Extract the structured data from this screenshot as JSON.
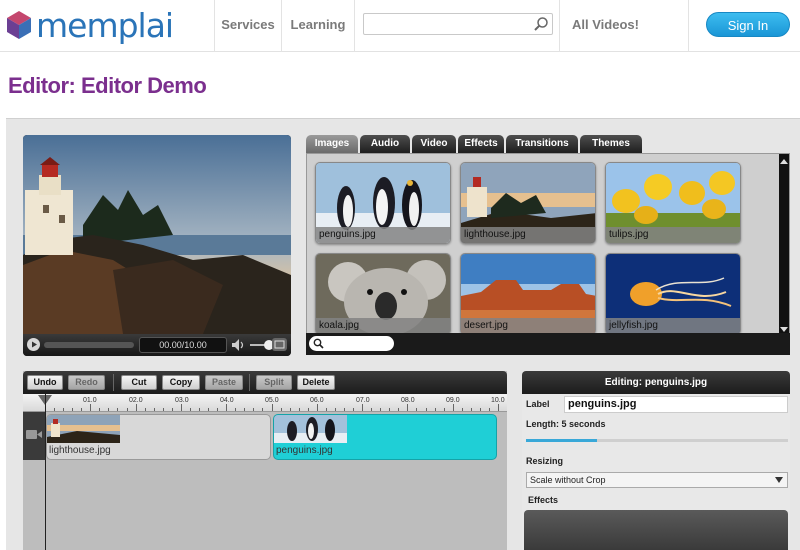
{
  "header": {
    "brand": "memplai",
    "nav": [
      "Services",
      "Learning"
    ],
    "search": {
      "value": "",
      "placeholder": ""
    },
    "all_videos": "All Videos!",
    "sign_in": "Sign In"
  },
  "page_title": "Editor: Editor Demo",
  "player": {
    "time": "00.00/10.00",
    "progress_fraction": 0.0,
    "volume_fraction": 0.6
  },
  "library": {
    "tabs": [
      "Images",
      "Audio",
      "Video",
      "Effects",
      "Transitions",
      "Themes"
    ],
    "active_tab": "Images",
    "items": [
      {
        "label": "penguins.jpg",
        "image": "penguins"
      },
      {
        "label": "lighthouse.jpg",
        "image": "lighthouse"
      },
      {
        "label": "tulips.jpg",
        "image": "tulips"
      },
      {
        "label": "koala.jpg",
        "image": "koala"
      },
      {
        "label": "desert.jpg",
        "image": "desert"
      },
      {
        "label": "jellyfish.jpg",
        "image": "jellyfish"
      }
    ],
    "search": {
      "value": "",
      "placeholder": ""
    }
  },
  "timeline": {
    "buttons": [
      "Undo",
      "Redo",
      "Cut",
      "Copy",
      "Paste",
      "Split",
      "Delete"
    ],
    "disabled_buttons": [
      "Redo",
      "Paste",
      "Split"
    ],
    "ruler": [
      "01.0",
      "02.0",
      "03.0",
      "04.0",
      "05.0",
      "06.0",
      "07.0",
      "08.0",
      "09.0",
      "10.0"
    ],
    "clips": [
      {
        "label": "lighthouse.jpg",
        "image": "lighthouse",
        "selected": false
      },
      {
        "label": "penguins.jpg",
        "image": "penguins",
        "selected": true
      }
    ]
  },
  "properties": {
    "title": "Editing: penguins.jpg",
    "label_caption": "Label",
    "label_value": "penguins.jpg",
    "length": "Length: 5 seconds",
    "length_fraction": 0.27,
    "resizing_caption": "Resizing",
    "resizing_value": "Scale without Crop",
    "effects_caption": "Effects"
  },
  "colors": {
    "title": "#7b2f8e",
    "brand": "#2a74b8",
    "accent": "#39a8d8",
    "selected_clip": "#1fcfd6"
  }
}
